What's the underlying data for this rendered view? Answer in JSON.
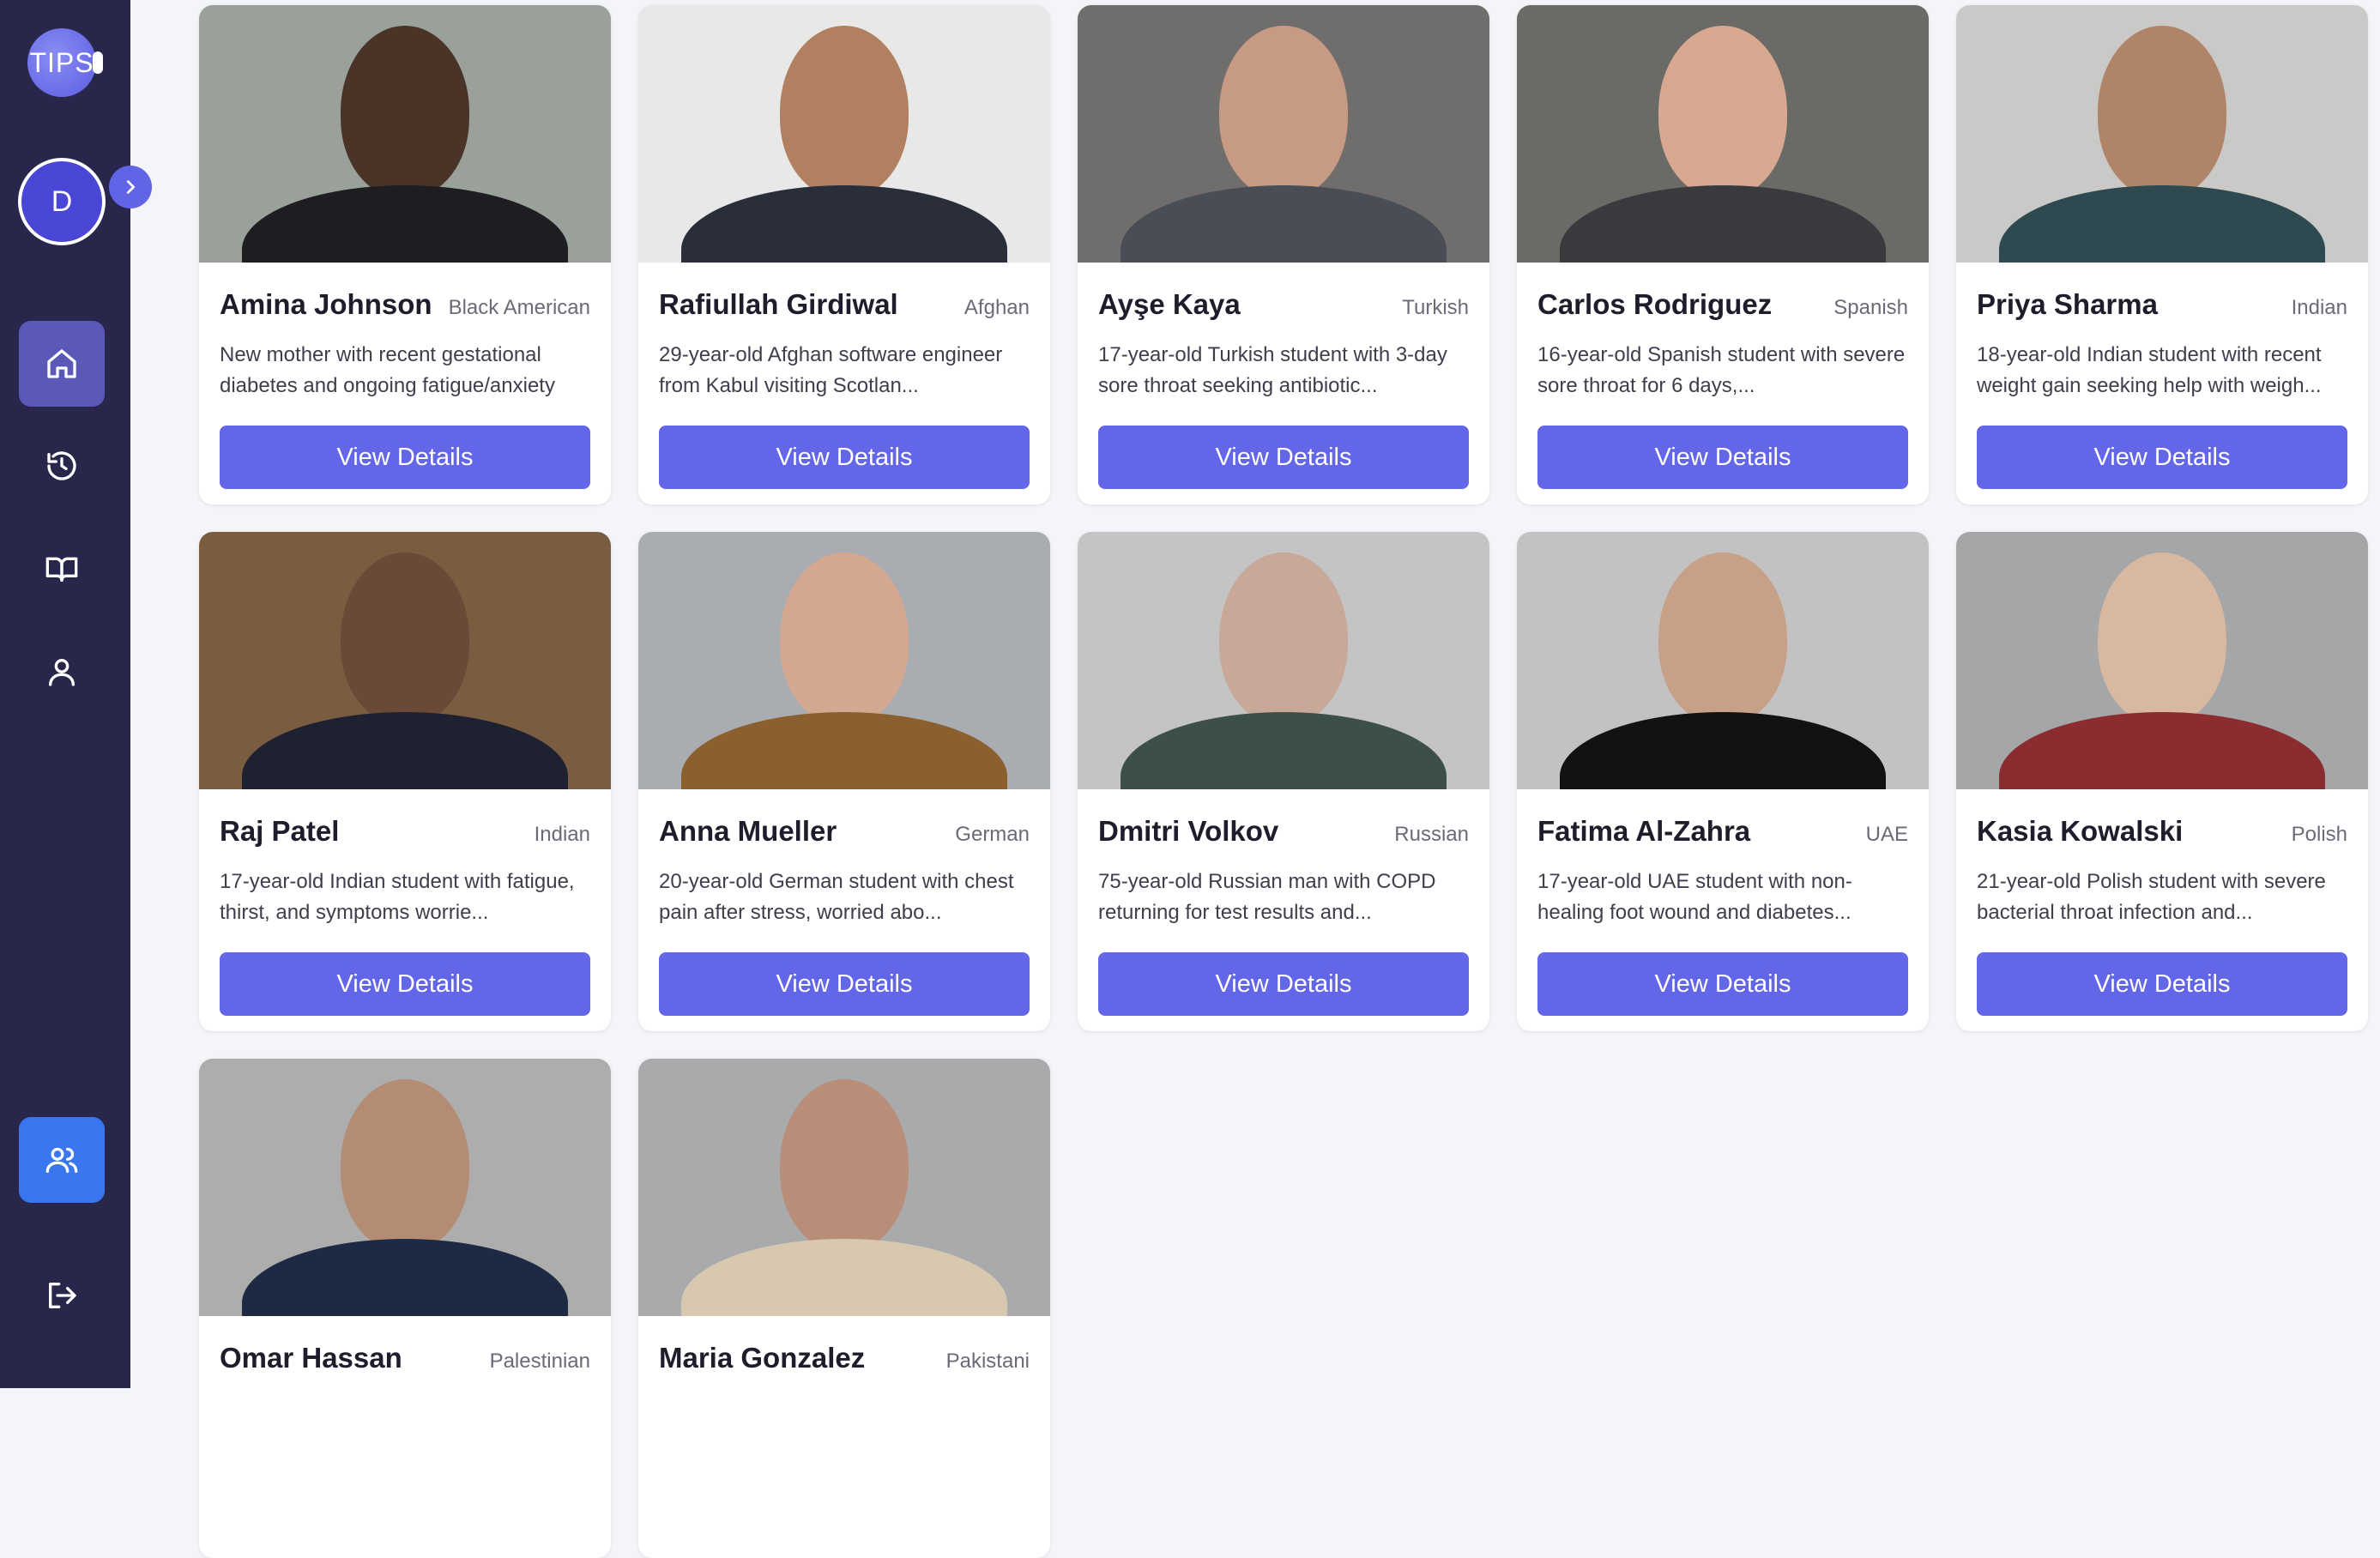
{
  "sidebar": {
    "logo_text": "TIPS",
    "avatar_initial": "D",
    "nav": [
      {
        "icon": "home-icon"
      },
      {
        "icon": "history-icon"
      },
      {
        "icon": "book-icon"
      },
      {
        "icon": "user-icon"
      }
    ],
    "users_icon": "users-icon",
    "logout_icon": "logout-icon"
  },
  "patients": [
    {
      "name": "Amina Johnson",
      "nationality": "Black American",
      "description": "New mother with recent gestational diabetes and ongoing fatigue/anxiety",
      "button": "View Details"
    },
    {
      "name": "Rafiullah Girdiwal",
      "nationality": "Afghan",
      "description": "29-year-old Afghan software engineer from Kabul visiting Scotlan...",
      "button": "View Details"
    },
    {
      "name": "Ayşe Kaya",
      "nationality": "Turkish",
      "description": "17-year-old Turkish student with 3-day sore throat seeking antibiotic...",
      "button": "View Details"
    },
    {
      "name": "Carlos Rodriguez",
      "nationality": "Spanish",
      "description": "16-year-old Spanish student with severe sore throat for 6 days,...",
      "button": "View Details"
    },
    {
      "name": "Priya Sharma",
      "nationality": "Indian",
      "description": "18-year-old Indian student with recent weight gain seeking help with weigh...",
      "button": "View Details"
    },
    {
      "name": "Raj Patel",
      "nationality": "Indian",
      "description": "17-year-old Indian student with fatigue, thirst, and symptoms worrie...",
      "button": "View Details"
    },
    {
      "name": "Anna Mueller",
      "nationality": "German",
      "description": "20-year-old German student with chest pain after stress, worried abo...",
      "button": "View Details"
    },
    {
      "name": "Dmitri Volkov",
      "nationality": "Russian",
      "description": "75-year-old Russian man with COPD returning for test results and...",
      "button": "View Details"
    },
    {
      "name": "Fatima Al-Zahra",
      "nationality": "UAE",
      "description": "17-year-old UAE student with non-healing foot wound and diabetes...",
      "button": "View Details"
    },
    {
      "name": "Kasia Kowalski",
      "nationality": "Polish",
      "description": "21-year-old Polish student with severe bacterial throat infection and...",
      "button": "View Details"
    },
    {
      "name": "Omar Hassan",
      "nationality": "Palestinian",
      "description": "",
      "button": ""
    },
    {
      "name": "Maria Gonzalez",
      "nationality": "Pakistani",
      "description": "",
      "button": ""
    }
  ],
  "colors": {
    "sidebar_bg": "#28264a",
    "accent": "#6366e6",
    "users_button": "#3a76f0",
    "page_bg": "#f4f5fa"
  }
}
